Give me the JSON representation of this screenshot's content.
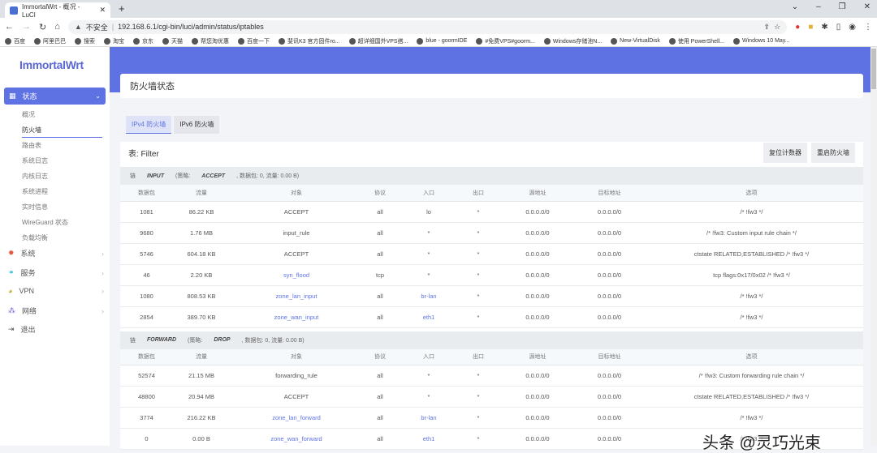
{
  "browser": {
    "tab_title": "ImmortalWrt - 概况 - LuCI",
    "security": "不安全",
    "url": "192.168.6.1/cgi-bin/luci/admin/status/iptables",
    "bookmarks": [
      "百度",
      "阿里巴巴",
      "搜索",
      "淘宝",
      "京东",
      "天猫",
      "帮您淘优惠",
      "百度一下",
      "斐讯K3 官方固件ro...",
      "超详细国外VPS搭...",
      "blue - goormIDE",
      "#免费VPS#goorm...",
      "Windows存储池N...",
      "New-VirtualDisk",
      "使用 PowerShell...",
      "Windows 10 May..."
    ]
  },
  "sidebar": {
    "logo": "ImmortalWrt",
    "active": "状态",
    "sub": [
      "概况",
      "防火墙",
      "路由表",
      "系统日志",
      "内核日志",
      "系统进程",
      "实时信息",
      "WireGuard 状态",
      "负载均衡"
    ],
    "items": [
      "系统",
      "服务",
      "VPN",
      "网络",
      "退出"
    ]
  },
  "page": {
    "title": "防火墙状态",
    "tabs": [
      "IPv4 防火墙",
      "IPv6 防火墙"
    ],
    "table_title": "表: Filter",
    "reset_button": "复位计数器",
    "restart_button": "重启防火墙"
  },
  "columns": [
    "数据包",
    "流量",
    "对象",
    "协议",
    "入口",
    "出口",
    "源地址",
    "目标地址",
    "选项"
  ],
  "chains": [
    {
      "label": "链",
      "name": "INPUT",
      "policy_label": "(策略:",
      "policy": "ACCEPT",
      "stats": ", 数据包: 0, 流量: 0.00 B)",
      "rows": [
        [
          "1081",
          "86.22 KB",
          "ACCEPT",
          "all",
          "lo",
          "*",
          "0.0.0.0/0",
          "0.0.0.0/0",
          "/* !fw3 */"
        ],
        [
          "9680",
          "1.76 MB",
          "input_rule",
          "all",
          "*",
          "*",
          "0.0.0.0/0",
          "0.0.0.0/0",
          "/* !fw3: Custom input rule chain */"
        ],
        [
          "5746",
          "604.18 KB",
          "ACCEPT",
          "all",
          "*",
          "*",
          "0.0.0.0/0",
          "0.0.0.0/0",
          "ctstate RELATED,ESTABLISHED /* !fw3 */"
        ],
        [
          "46",
          "2.20 KB",
          "syn_flood",
          "tcp",
          "*",
          "*",
          "0.0.0.0/0",
          "0.0.0.0/0",
          "tcp flags:0x17/0x02 /* !fw3 */"
        ],
        [
          "1080",
          "808.53 KB",
          "zone_lan_input",
          "all",
          "br-lan",
          "*",
          "0.0.0.0/0",
          "0.0.0.0/0",
          "/* !fw3 */"
        ],
        [
          "2854",
          "389.70 KB",
          "zone_wan_input",
          "all",
          "eth1",
          "*",
          "0.0.0.0/0",
          "0.0.0.0/0",
          "/* !fw3 */"
        ]
      ]
    },
    {
      "label": "链",
      "name": "FORWARD",
      "policy_label": "(策略:",
      "policy": "DROP",
      "stats": ", 数据包: 0, 流量: 0.00 B)",
      "rows": [
        [
          "52574",
          "21.15 MB",
          "forwarding_rule",
          "all",
          "*",
          "*",
          "0.0.0.0/0",
          "0.0.0.0/0",
          "/* !fw3: Custom forwarding rule chain */"
        ],
        [
          "48800",
          "20.94 MB",
          "ACCEPT",
          "all",
          "*",
          "*",
          "0.0.0.0/0",
          "0.0.0.0/0",
          "ctstate RELATED,ESTABLISHED /* !fw3 */"
        ],
        [
          "3774",
          "216.22 KB",
          "zone_lan_forward",
          "all",
          "br-lan",
          "*",
          "0.0.0.0/0",
          "0.0.0.0/0",
          "/* !fw3 */"
        ],
        [
          "0",
          "0.00 B",
          "zone_wan_forward",
          "all",
          "eth1",
          "*",
          "0.0.0.0/0",
          "0.0.0.0/0",
          "/* !fw3 */"
        ]
      ]
    }
  ],
  "watermark": "头条 @灵巧光束",
  "colors": {
    "accent": "#5e72e4"
  }
}
